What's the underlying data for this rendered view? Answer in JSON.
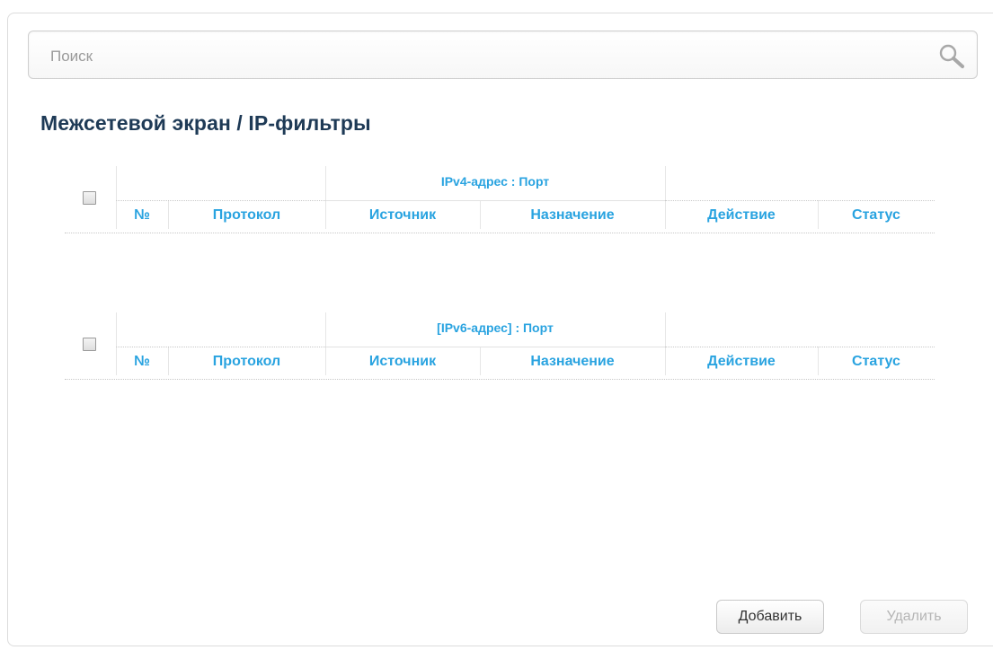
{
  "search": {
    "placeholder": "Поиск",
    "value": ""
  },
  "page_title": "Межсетевой экран /  IP-фильтры",
  "ipv4_table": {
    "group_header": "IPv4-адрес : Порт",
    "columns": [
      "№",
      "Протокол",
      "Источник",
      "Назначение",
      "Действие",
      "Статус"
    ],
    "rows": []
  },
  "ipv6_table": {
    "group_header": "[IPv6-адрес] : Порт",
    "columns": [
      "№",
      "Протокол",
      "Источник",
      "Назначение",
      "Действие",
      "Статус"
    ],
    "rows": []
  },
  "buttons": {
    "add": "Добавить",
    "delete": "Удалить"
  },
  "colors": {
    "accent": "#29a3e0",
    "title": "#1e3a56",
    "disabled_text": "#b5b5b5"
  },
  "icons": {
    "search": "magnifier-icon"
  }
}
